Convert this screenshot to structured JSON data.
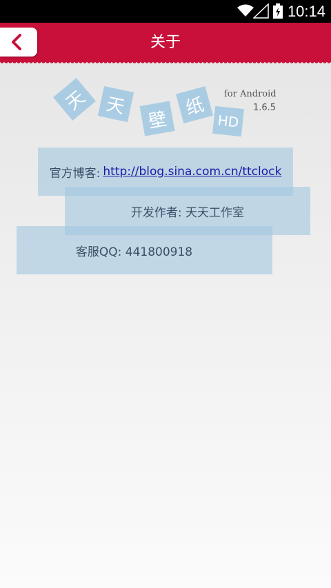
{
  "status_bar": {
    "time": "10:14",
    "icons": [
      "wifi-icon",
      "signal-icon",
      "battery-charging-icon"
    ]
  },
  "title_bar": {
    "title": "关于",
    "back_icon": "chevron-left-icon",
    "color": "#c8103a"
  },
  "logo": {
    "characters": [
      "天",
      "天",
      "壁",
      "纸",
      "HD"
    ],
    "platform": "for Android",
    "version": "1.6.5"
  },
  "info": {
    "blog_label": "官方博客:",
    "blog_url": "http://blog.sina.com.cn/ttclock",
    "developer": "开发作者: 天天工作室",
    "support": "客服QQ: 441800918"
  }
}
